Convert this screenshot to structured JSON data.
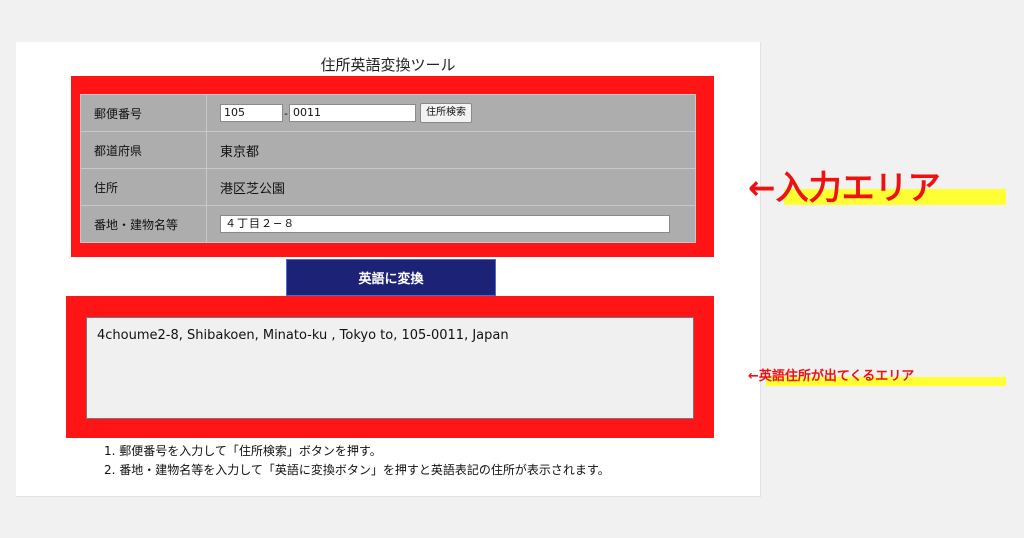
{
  "page": {
    "title": "住所英語変換ツール"
  },
  "form": {
    "postal_label": "郵便番号",
    "postal_part1": "105",
    "postal_separator": "-",
    "postal_part2": "0011",
    "search_button": "住所検索",
    "prefecture_label": "都道府県",
    "prefecture_value": "東京都",
    "address_label": "住所",
    "address_value": "港区芝公園",
    "street_label": "番地・建物名等",
    "street_value": "４丁目２−８"
  },
  "convert_button": "英語に変換",
  "output": {
    "text": "4choume2-8, Shibakoen, Minato-ku , Tokyo to, 105-0011, Japan"
  },
  "instructions": [
    "1. 郵便番号を入力して「住所検索」ボタンを押す。",
    "2. 番地・建物名等を入力して「英語に変換ボタン」を押すと英語表記の住所が表示されます。"
  ],
  "annotations": {
    "input_area": "←入力エリア",
    "output_area": "←英語住所が出てくるエリア"
  },
  "colors": {
    "highlight_frame": "#ff1515",
    "button_bg": "#1c2377",
    "table_bg": "#adadad",
    "marker_yellow": "#ffff33",
    "annotation_text": "#ee1111"
  }
}
